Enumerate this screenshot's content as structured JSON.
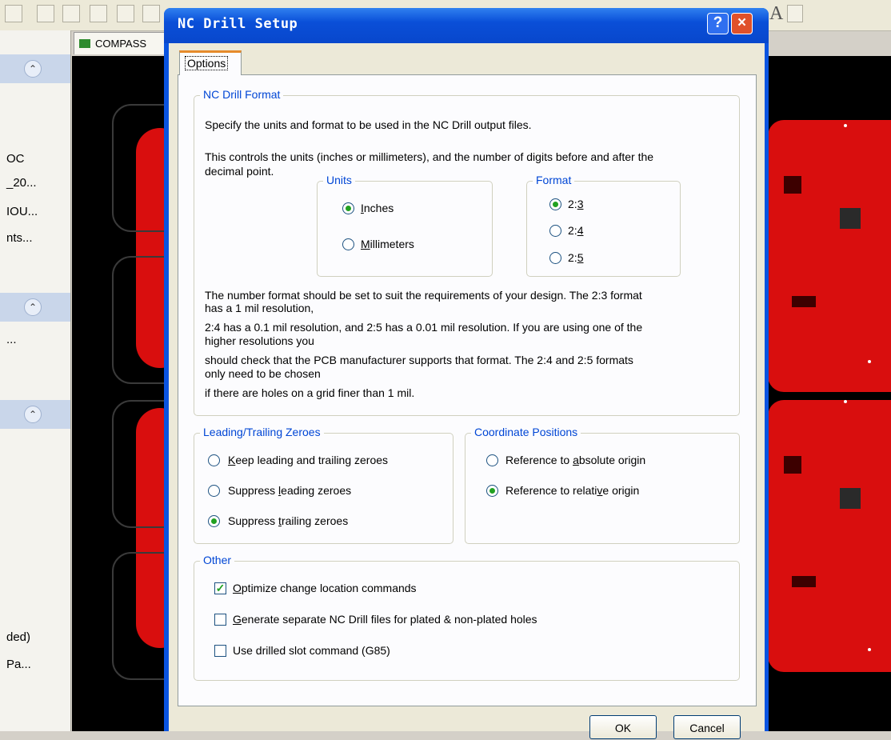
{
  "background": {
    "doc_tab": "COMPASS",
    "left_panel_items": [
      "OC",
      "_20...",
      "IOU...",
      "nts...",
      "...",
      "ded)",
      "Pa..."
    ]
  },
  "dialog": {
    "title": "NC Drill Setup",
    "help_label": "?",
    "close_label": "×",
    "tab": "Options",
    "nc_format": {
      "title": "NC Drill Format",
      "desc1": "Specify the units and format to be used in the NC Drill output files.",
      "desc2a": "This controls the units (inches or millimeters), and the number of digits before and after the",
      "desc2b": "decimal point.",
      "units_title": "Units",
      "units": [
        {
          "pre": "",
          "key": "I",
          "post": "nches",
          "selected": true
        },
        {
          "pre": "",
          "key": "M",
          "post": "illimeters",
          "selected": false
        }
      ],
      "format_title": "Format",
      "formats": [
        {
          "pre": "2:",
          "key": "3",
          "post": "",
          "selected": true
        },
        {
          "pre": "2:",
          "key": "4",
          "post": "",
          "selected": false
        },
        {
          "pre": "2:",
          "key": "5",
          "post": "",
          "selected": false
        }
      ],
      "note": [
        "The number format should be set to suit the requirements of your design. The 2:3 format",
        "has a 1 mil resolution,",
        "2:4 has a 0.1 mil resolution, and 2:5 has a 0.01 mil resolution. If you are using one of the",
        "higher resolutions you",
        "should check that the PCB manufacturer supports that format. The 2:4 and 2:5 formats",
        "only need to be chosen",
        "if there are holes on a grid finer than 1 mil."
      ]
    },
    "zeroes": {
      "title": "Leading/Trailing Zeroes",
      "options": [
        {
          "pre": "",
          "key": "K",
          "post": "eep leading and trailing zeroes",
          "selected": false
        },
        {
          "pre": "Suppress ",
          "key": "l",
          "post": "eading zeroes",
          "selected": false
        },
        {
          "pre": "Suppress ",
          "key": "t",
          "post": "railing zeroes",
          "selected": true
        }
      ]
    },
    "coords": {
      "title": "Coordinate Positions",
      "options": [
        {
          "pre": "Reference to ",
          "key": "a",
          "post": "bsolute origin",
          "selected": false
        },
        {
          "pre": "Reference to relati",
          "key": "v",
          "post": "e origin",
          "selected": true
        }
      ]
    },
    "other": {
      "title": "Other",
      "options": [
        {
          "pre": "",
          "key": "O",
          "post": "ptimize change location commands",
          "checked": true
        },
        {
          "pre": "",
          "key": "G",
          "post": "enerate separate NC Drill files for plated & non-plated holes",
          "checked": false
        },
        {
          "pre": "Use drilled slot command (G85)",
          "key": "",
          "post": "",
          "checked": false
        }
      ]
    },
    "ok_label": "OK",
    "cancel_label": "Cancel"
  }
}
